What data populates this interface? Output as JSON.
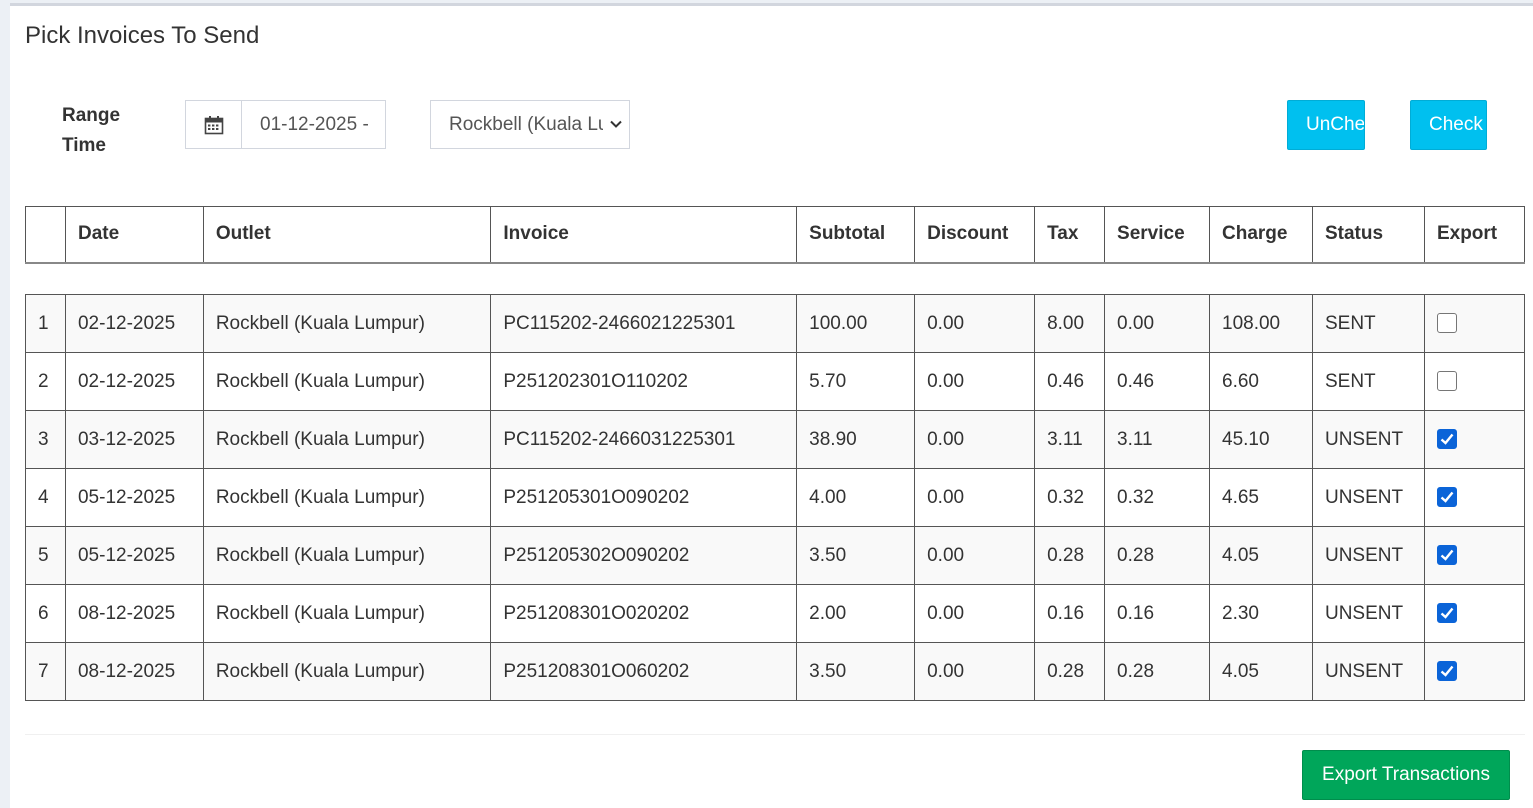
{
  "page": {
    "title": "Pick Invoices To Send"
  },
  "filters": {
    "range_label": "Range Time",
    "date_icon": "calendar-icon",
    "date_value": "01-12-2025 -",
    "outlet_selected": "Rockbell (Kuala Lumpur)",
    "dropdown_icon": "chevron-down-icon"
  },
  "buttons": {
    "uncheck_label": "UnCheck",
    "check_label": "Check",
    "export_label": "Export Transactions"
  },
  "colors": {
    "info": "#00c0ef",
    "success": "#00a65a",
    "checkbox_checked": "#0b64d8"
  },
  "table": {
    "columns": [
      "",
      "Date",
      "Outlet",
      "Invoice",
      "Subtotal",
      "Discount",
      "Tax",
      "Service",
      "Charge",
      "Status",
      "Export"
    ],
    "rows": [
      {
        "no": "1",
        "date": "02-12-2025",
        "outlet": "Rockbell (Kuala Lumpur)",
        "invoice": "PC115202-2466021225301",
        "subtotal": "100.00",
        "discount": "0.00",
        "tax": "8.00",
        "service": "0.00",
        "charge": "108.00",
        "status": "SENT",
        "export": false
      },
      {
        "no": "2",
        "date": "02-12-2025",
        "outlet": "Rockbell (Kuala Lumpur)",
        "invoice": "P251202301O110202",
        "subtotal": "5.70",
        "discount": "0.00",
        "tax": "0.46",
        "service": "0.46",
        "charge": "6.60",
        "status": "SENT",
        "export": false
      },
      {
        "no": "3",
        "date": "03-12-2025",
        "outlet": "Rockbell (Kuala Lumpur)",
        "invoice": "PC115202-2466031225301",
        "subtotal": "38.90",
        "discount": "0.00",
        "tax": "3.11",
        "service": "3.11",
        "charge": "45.10",
        "status": "UNSENT",
        "export": true
      },
      {
        "no": "4",
        "date": "05-12-2025",
        "outlet": "Rockbell (Kuala Lumpur)",
        "invoice": "P251205301O090202",
        "subtotal": "4.00",
        "discount": "0.00",
        "tax": "0.32",
        "service": "0.32",
        "charge": "4.65",
        "status": "UNSENT",
        "export": true
      },
      {
        "no": "5",
        "date": "05-12-2025",
        "outlet": "Rockbell (Kuala Lumpur)",
        "invoice": "P251205302O090202",
        "subtotal": "3.50",
        "discount": "0.00",
        "tax": "0.28",
        "service": "0.28",
        "charge": "4.05",
        "status": "UNSENT",
        "export": true
      },
      {
        "no": "6",
        "date": "08-12-2025",
        "outlet": "Rockbell (Kuala Lumpur)",
        "invoice": "P251208301O020202",
        "subtotal": "2.00",
        "discount": "0.00",
        "tax": "0.16",
        "service": "0.16",
        "charge": "2.30",
        "status": "UNSENT",
        "export": true
      },
      {
        "no": "7",
        "date": "08-12-2025",
        "outlet": "Rockbell (Kuala Lumpur)",
        "invoice": "P251208301O060202",
        "subtotal": "3.50",
        "discount": "0.00",
        "tax": "0.28",
        "service": "0.28",
        "charge": "4.05",
        "status": "UNSENT",
        "export": true
      }
    ]
  }
}
